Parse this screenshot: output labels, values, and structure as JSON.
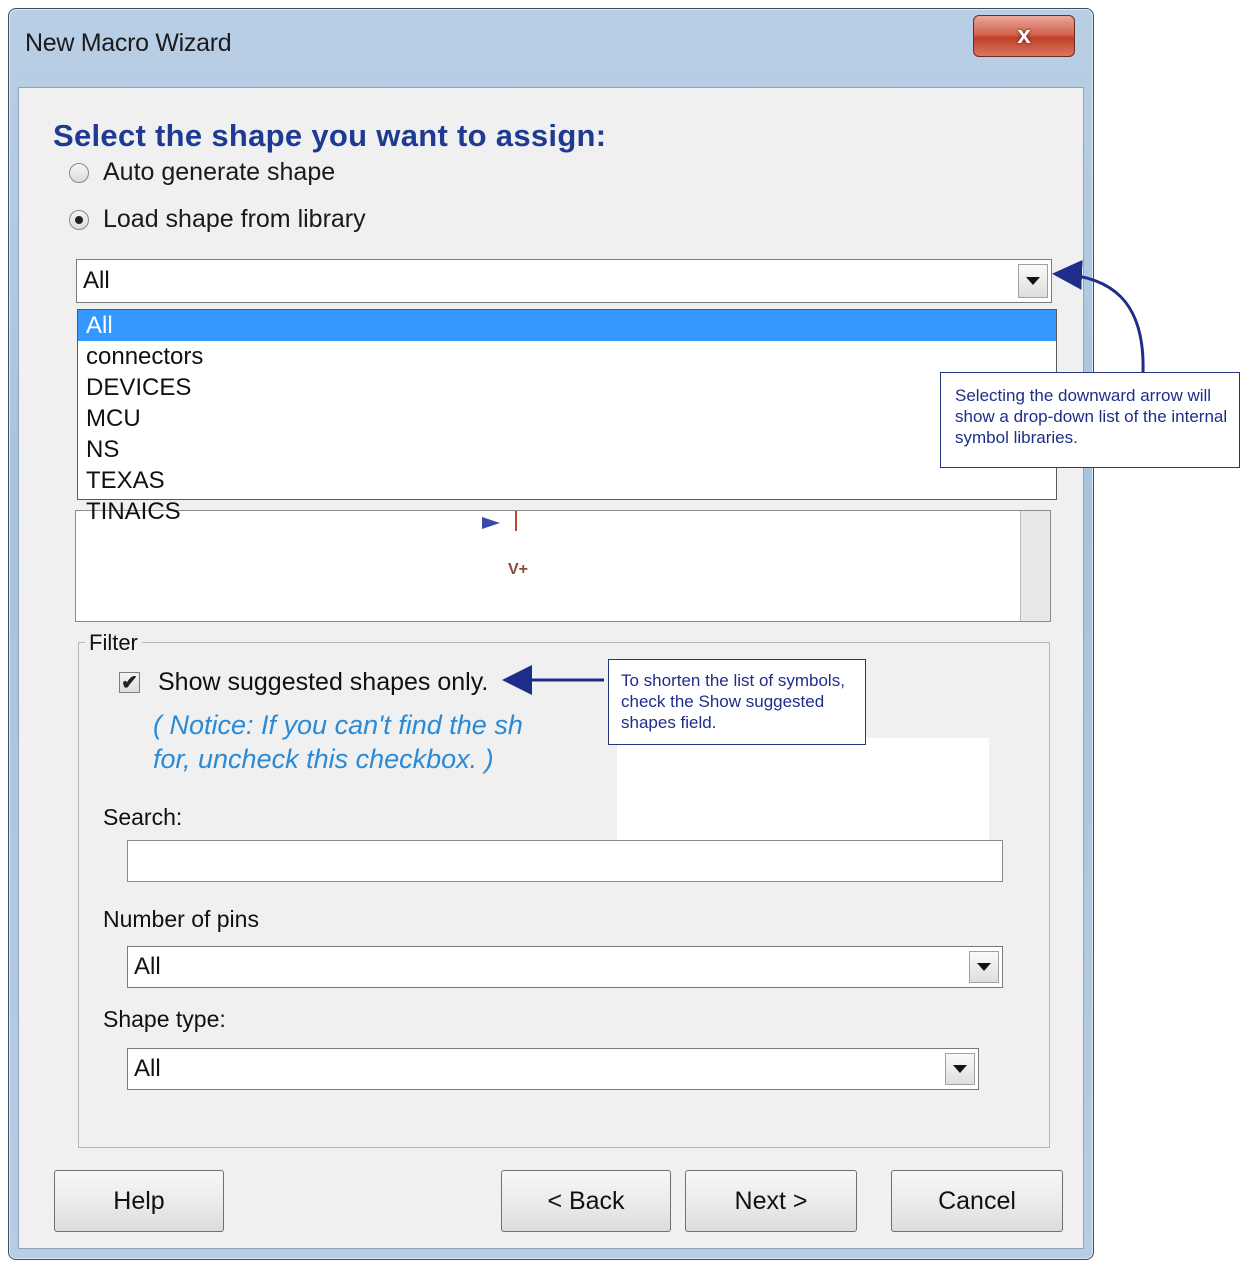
{
  "window": {
    "title": "New Macro Wizard",
    "close_glyph": "x"
  },
  "wizard": {
    "heading": "Select the shape you want to assign:",
    "radio_auto": "Auto generate shape",
    "radio_library": "Load shape from library",
    "library_combo_value": "All",
    "library_options": [
      "All",
      "connectors",
      "DEVICES",
      "MCU",
      "NS",
      "TEXAS",
      "TINAICS"
    ],
    "library_selected_index": 0,
    "preview_pin_label": "V+"
  },
  "filter": {
    "legend": "Filter",
    "suggested_checkbox": "Show suggested shapes only.",
    "suggested_checked": true,
    "notice_line1": "( Notice: If you can't find the sh",
    "notice_line2": "for, uncheck this checkbox. )",
    "search_label": "Search:",
    "search_value": "",
    "pins_label": "Number of pins",
    "pins_value": "All",
    "shape_type_label": "Shape type:",
    "shape_type_value": "All"
  },
  "buttons": {
    "help": "Help",
    "back": "< Back",
    "next": "Next >",
    "cancel": "Cancel"
  },
  "annotations": {
    "arrow_callout": "Selecting the downward arrow will show a drop-down list of the internal symbol libraries.",
    "checkbox_callout": "To shorten  the list of symbols, check the Show suggested shapes field."
  },
  "colors": {
    "heading": "#1f3a93",
    "notice": "#2b8ad6",
    "selection": "#3399ff",
    "annotation": "#26337d"
  },
  "icons": [
    "close-icon",
    "chevron-down-icon",
    "checkmark-icon",
    "callout-arrow"
  ]
}
